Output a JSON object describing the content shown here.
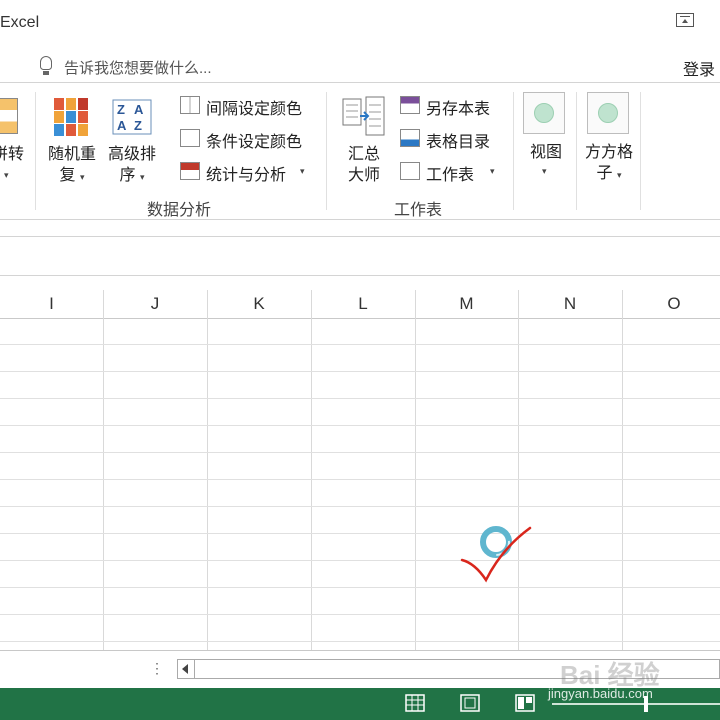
{
  "title_bar": {
    "app_name": "Excel"
  },
  "tell_me": {
    "placeholder": "告诉我您想要做什么...",
    "login": "登录"
  },
  "ribbon": {
    "partial_left_button": {
      "line1": "拼转",
      "caret": "▾"
    },
    "shuffle": {
      "line1": "随机重",
      "line2": "复"
    },
    "advanced_sort": {
      "line1": "高级排",
      "line2": "序"
    },
    "interval_color": "间隔设定颜色",
    "conditional_color": "条件设定颜色",
    "stats_analysis": "统计与分析",
    "data_analysis_group": "数据分析",
    "summary_master": {
      "line1": "汇总",
      "line2": "大师"
    },
    "save_as_table": "另存本表",
    "table_directory": "表格目录",
    "worksheet": "工作表",
    "worksheet_group": "工作表",
    "view": {
      "line1": "视图"
    },
    "square_grid": {
      "line1": "方方格",
      "line2": "子"
    },
    "caret": "▾"
  },
  "columns": [
    "I",
    "J",
    "K",
    "L",
    "M",
    "N",
    "O"
  ],
  "sheet_tabs": {
    "dots": "⋮"
  },
  "watermark": {
    "logo": "Bai 经验",
    "url": "jingyan.baidu.com"
  },
  "colors": {
    "status_bar": "#217346",
    "annotation_check": "#d9261c"
  }
}
